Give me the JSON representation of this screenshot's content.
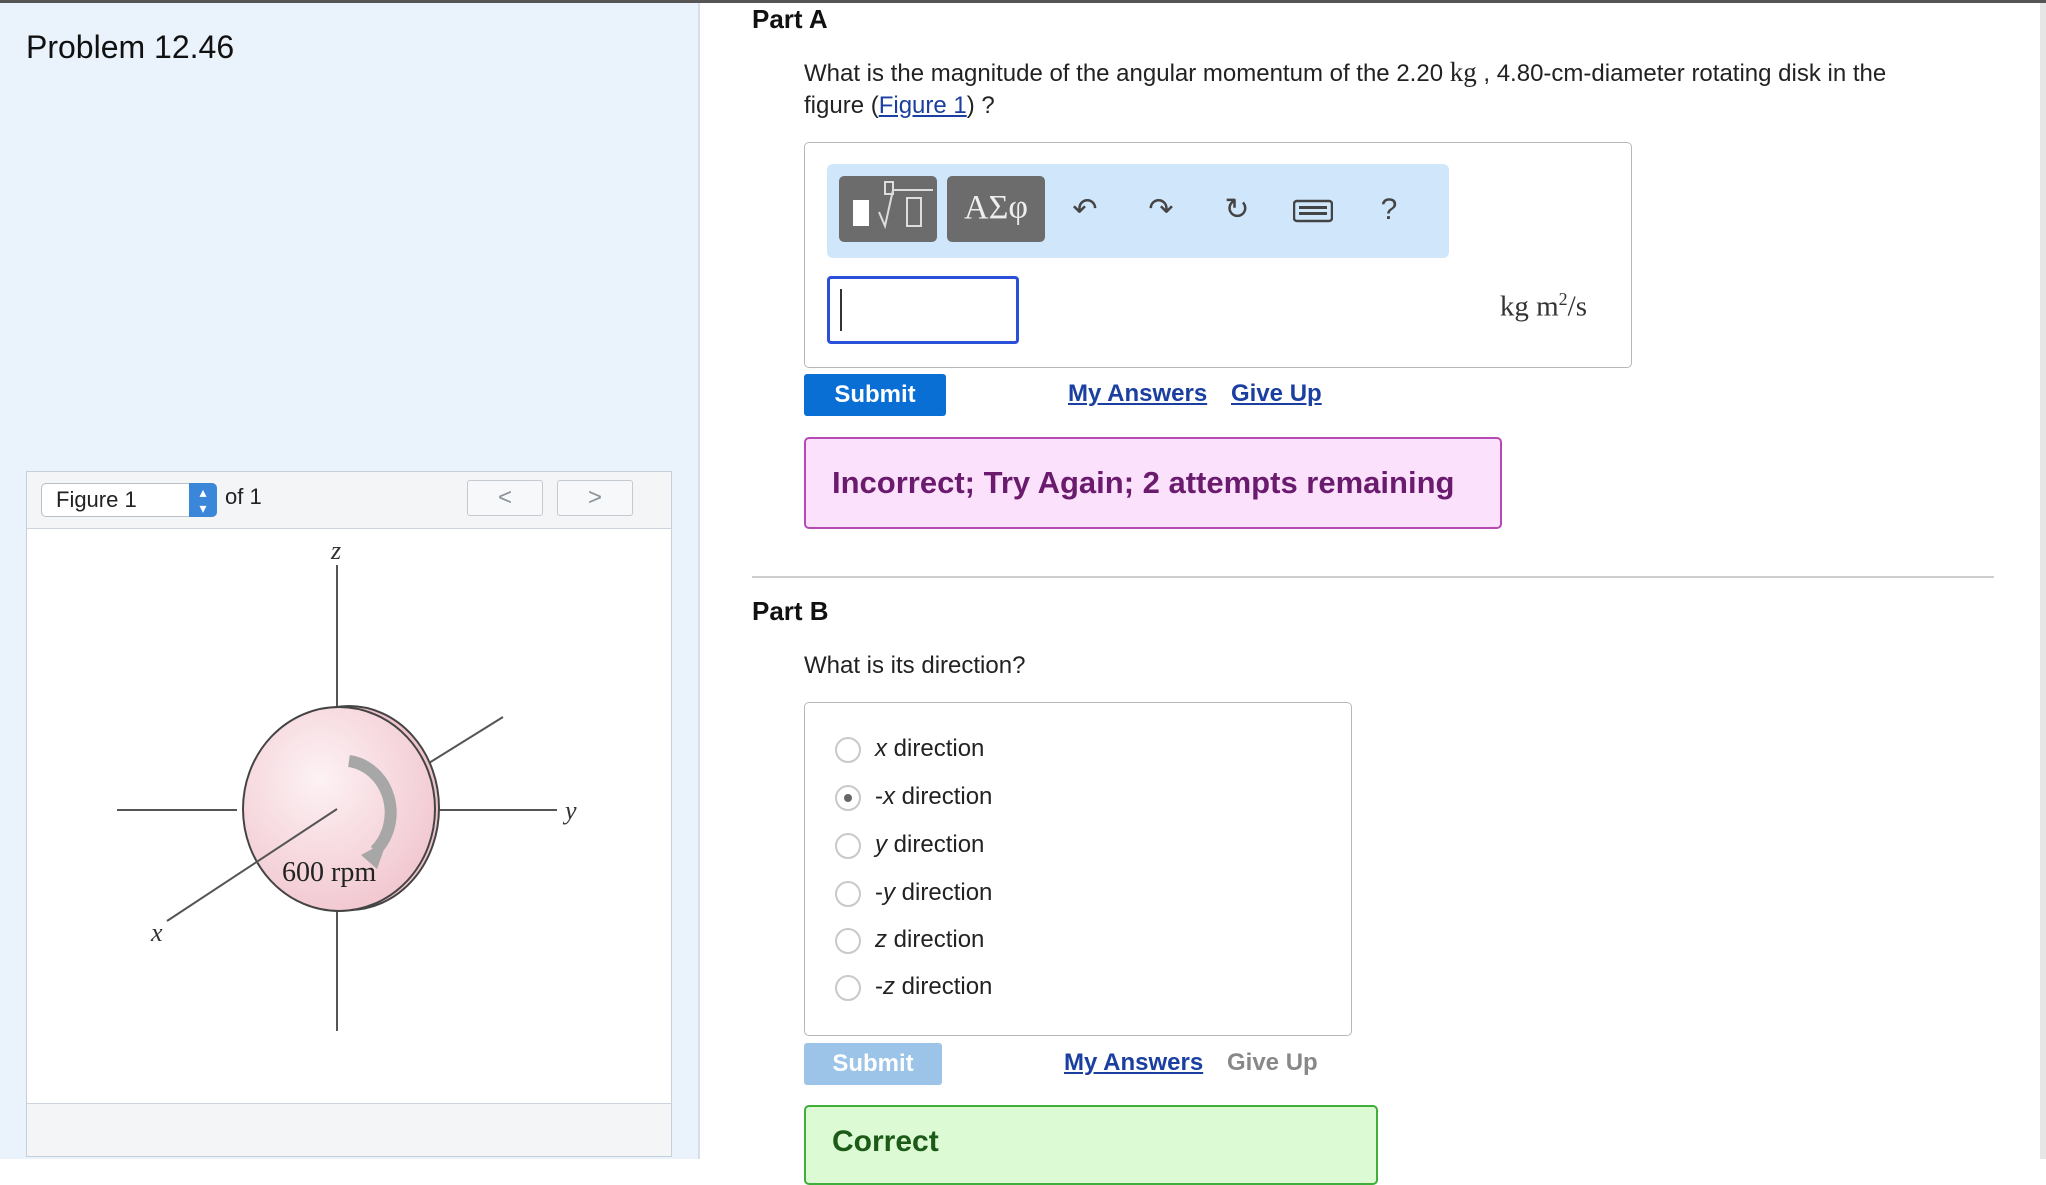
{
  "left_panel": {
    "problem_title": "Problem 12.46",
    "figure_viewer": {
      "selected_figure": "Figure 1",
      "of_label": "of 1",
      "prev_label": "<",
      "next_label": ">",
      "figure": {
        "axis_z": "z",
        "axis_y": "y",
        "axis_x": "x",
        "disk_label": "600 rpm"
      }
    }
  },
  "part_a": {
    "title": "Part A",
    "question_pre": "What is the magnitude of the angular momentum of the 2.20 ",
    "question_unit1": "kg",
    "question_mid": " , 4.80-cm-diameter rotating disk in the",
    "question_line2_pre": "figure (",
    "question_link": "Figure 1",
    "question_line2_post": ") ?",
    "toolbar": {
      "templates_icon": "templates-icon",
      "greek_label": "ΑΣφ",
      "undo_icon": "undo-icon",
      "redo_icon": "redo-icon",
      "reset_icon": "reset-icon",
      "keyboard_icon": "keyboard-icon",
      "help_label": "?"
    },
    "input_value": "",
    "units_text": "kg m",
    "units_sup": "2",
    "units_post": "/s",
    "submit_label": "Submit",
    "my_answers_label": "My Answers",
    "give_up_label": "Give Up",
    "feedback": "Incorrect; Try Again; 2 attempts remaining"
  },
  "part_b": {
    "title": "Part B",
    "question": "What is its direction?",
    "choices": [
      {
        "sign": "",
        "var": "x",
        "rest": " direction",
        "selected": false
      },
      {
        "sign": "-",
        "var": "x",
        "rest": " direction",
        "selected": true
      },
      {
        "sign": "",
        "var": "y",
        "rest": " direction",
        "selected": false
      },
      {
        "sign": "-",
        "var": "y",
        "rest": " direction",
        "selected": false
      },
      {
        "sign": "",
        "var": "z",
        "rest": " direction",
        "selected": false
      },
      {
        "sign": "-",
        "var": "z",
        "rest": " direction",
        "selected": false
      }
    ],
    "submit_label": "Submit",
    "my_answers_label": "My Answers",
    "give_up_label": "Give Up",
    "feedback": "Correct"
  },
  "colors": {
    "submit_active": "#0a6fd4",
    "submit_disabled": "#9cc4e8",
    "incorrect_bg": "#fbe1fb",
    "correct_bg": "#dcfbd4",
    "left_panel_bg": "#eaf2fb"
  }
}
